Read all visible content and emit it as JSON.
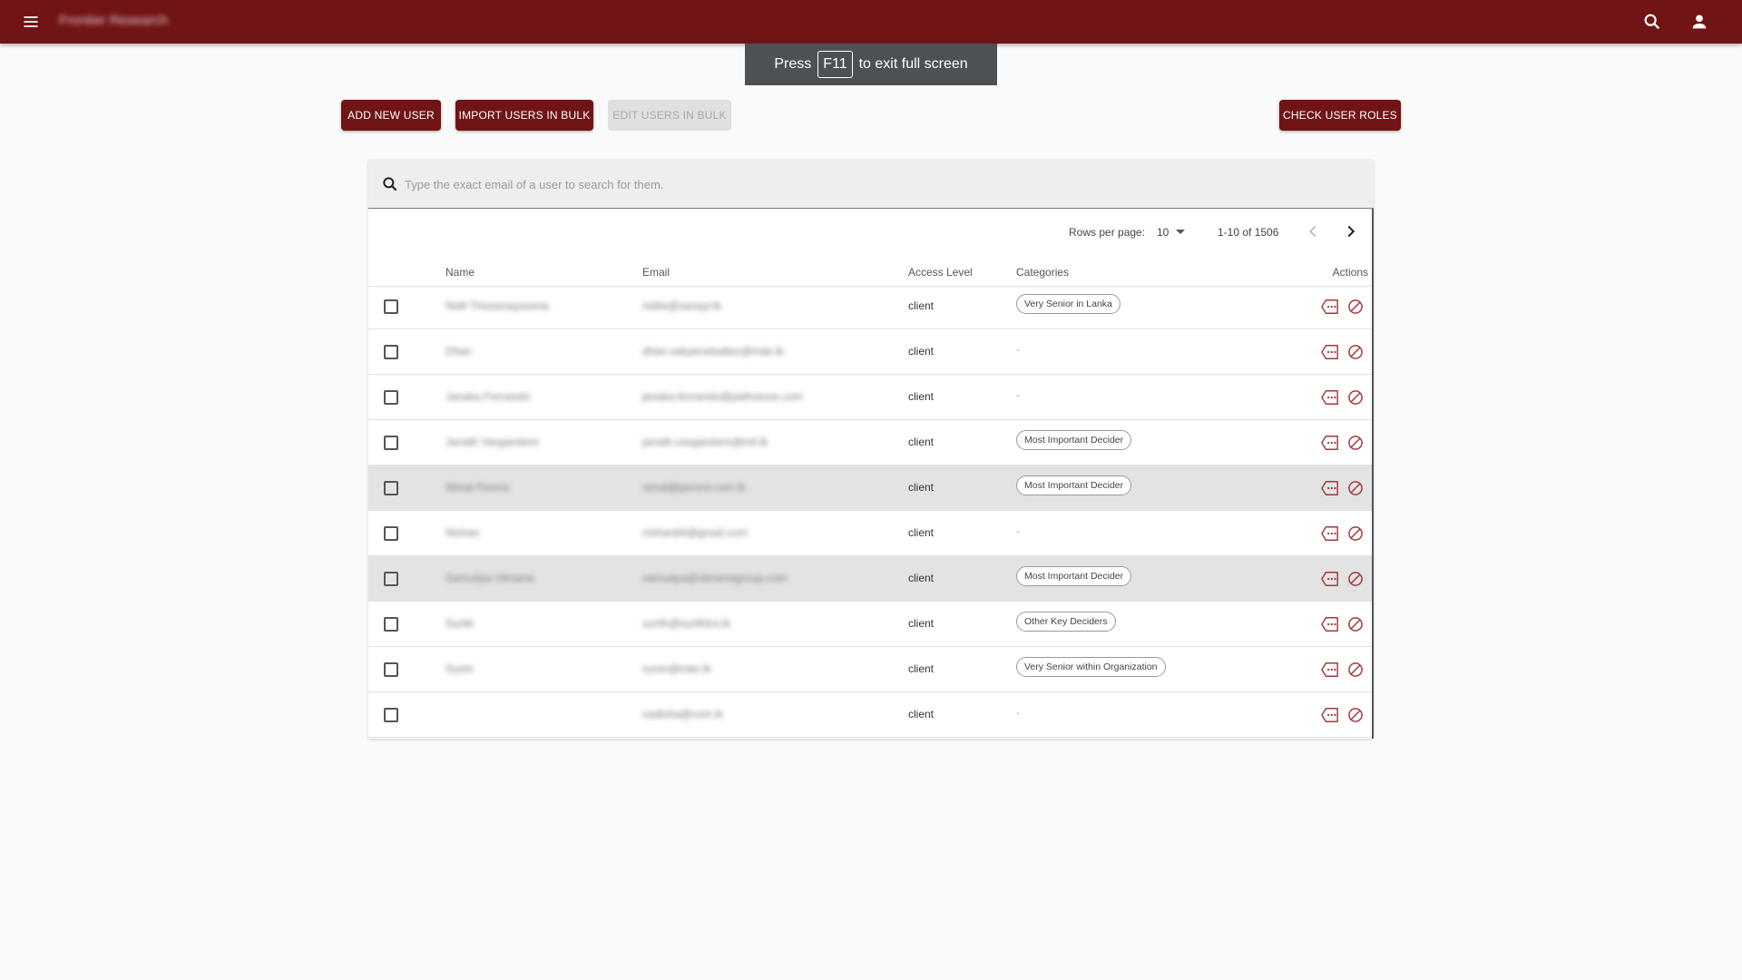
{
  "appbar": {
    "title": "Frontier Research",
    "menu_icon": "menu-icon",
    "search_icon": "search-icon",
    "account_icon": "account-icon"
  },
  "fullscreen_toast": {
    "press": "Press",
    "key": "F11",
    "message": "to exit full screen"
  },
  "toolbar": {
    "add_user": "ADD NEW USER",
    "import_bulk": "IMPORT USERS IN BULK",
    "edit_bulk": "EDIT USERS IN BULK",
    "check_roles": "CHECK USER ROLES"
  },
  "search": {
    "placeholder": "Type the exact email of a user to search for them.",
    "value": ""
  },
  "pagination": {
    "rows_per_page_label": "Rows per page:",
    "rows_per_page": "10",
    "range": "1-10 of 1506"
  },
  "table": {
    "headers": {
      "name": "Name",
      "email": "Email",
      "access": "Access Level",
      "categories": "Categories",
      "actions": "Actions"
    },
    "rows": [
      {
        "name": "Nidil Thissanayasena",
        "email": "nidila@sanayl.lk",
        "access": "client",
        "category": "Very Senior in Lanka",
        "highlighted": false
      },
      {
        "name": "Dhan",
        "email": "dhan.vakyanalsaltec@inde.lk",
        "access": "client",
        "category": "",
        "highlighted": false
      },
      {
        "name": "Janaka Fernando",
        "email": "janaka.fernando@pathstone.com",
        "access": "client",
        "category": "",
        "highlighted": false
      },
      {
        "name": "Janath Vasgandere",
        "email": "janath.vasgandere@intl.lk",
        "access": "client",
        "category": "Most Important Decider",
        "highlighted": false
      },
      {
        "name": "Nimal Perera",
        "email": "nimal@perera.com.lk",
        "access": "client",
        "category": "Most Important Decider",
        "highlighted": true
      },
      {
        "name": "Nishan",
        "email": "nishan84@gmail.com",
        "access": "client",
        "category": "",
        "highlighted": false
      },
      {
        "name": "Samudya Vikrama",
        "email": "samudya@vikramagroup.com",
        "access": "client",
        "category": "Most Important Decider",
        "highlighted": true
      },
      {
        "name": "Surith",
        "email": "surith@surithtra.lk",
        "access": "client",
        "category": "Other Key Deciders",
        "highlighted": false
      },
      {
        "name": "Sunin",
        "email": "sunin@inter.lk",
        "access": "client",
        "category": "Very Senior within Organization",
        "highlighted": false
      },
      {
        "name": "",
        "email": "nadisha@com.lk",
        "access": "client",
        "category": "",
        "highlighted": false
      }
    ],
    "empty_category": "-",
    "action_icons": [
      "tag-icon",
      "block-icon"
    ]
  },
  "colors": {
    "brand": "#701416",
    "action_icon": "#a03a3a"
  }
}
